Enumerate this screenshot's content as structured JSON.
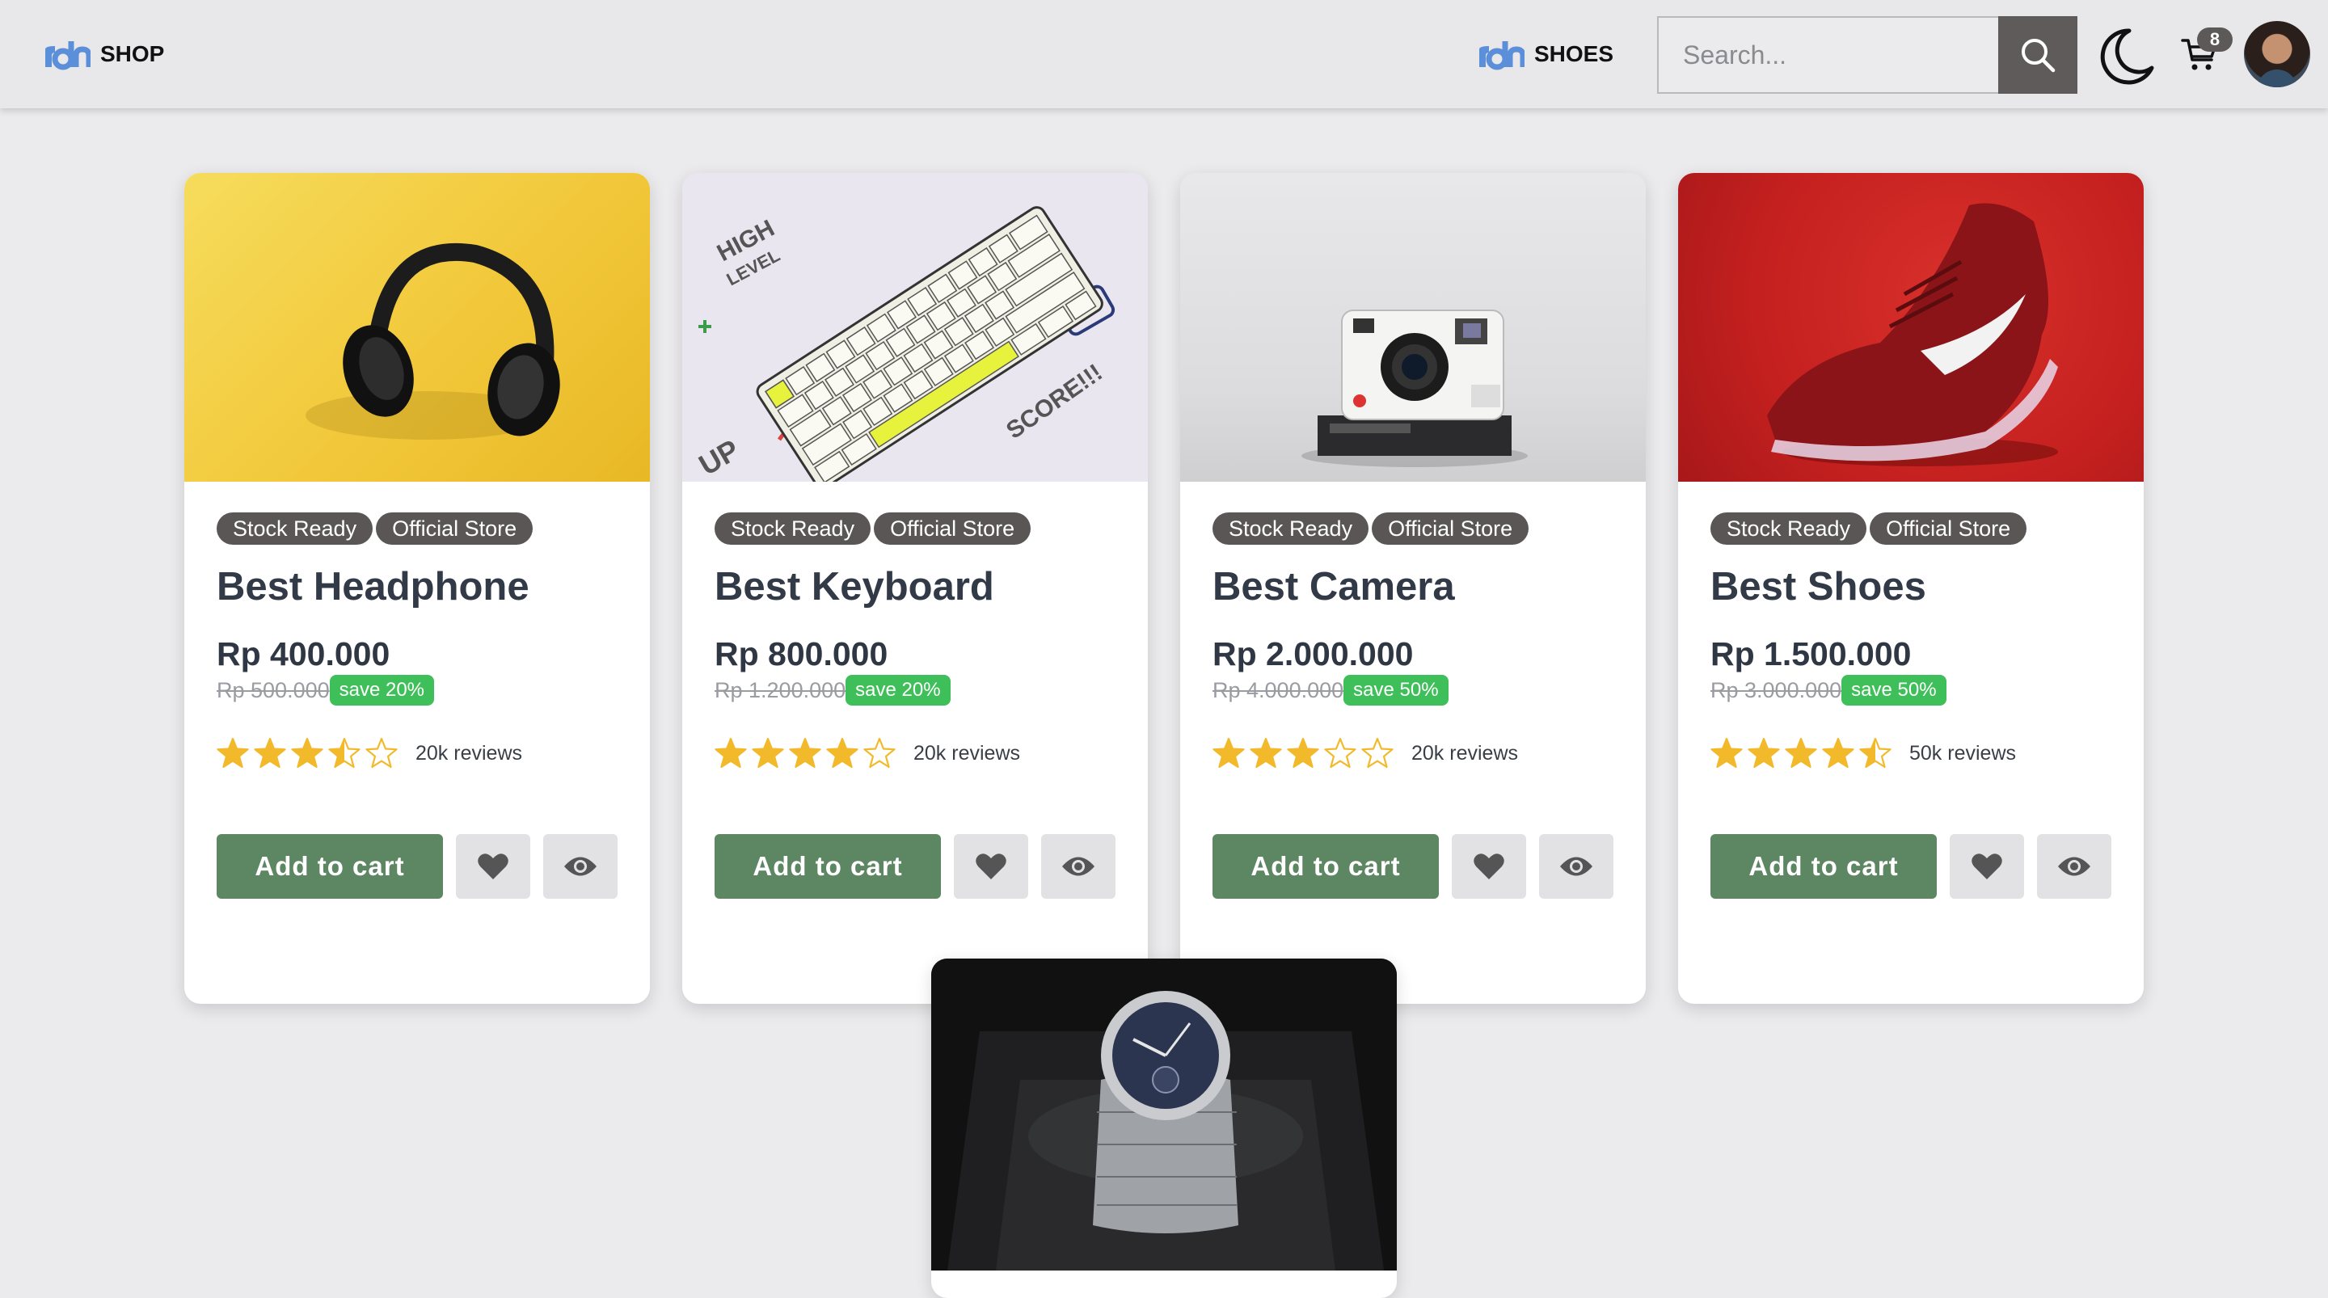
{
  "header": {
    "brand_left": "SHOP",
    "brand_right": "SHOES",
    "search_placeholder": "Search...",
    "cart_count": "8",
    "accent": "#5b8fd9"
  },
  "products": [
    {
      "tags": [
        "Stock Ready",
        "Official Store"
      ],
      "title": "Best Headphone",
      "price": "Rp 400.000",
      "old_price": "Rp 500.000",
      "save": "save 20%",
      "rating": 3.5,
      "reviews": "20k reviews",
      "cart_label": "Add to cart",
      "image": "headphone-photo"
    },
    {
      "tags": [
        "Stock Ready",
        "Official Store"
      ],
      "title": "Best Keyboard",
      "price": "Rp 800.000",
      "old_price": "Rp 1.200.000",
      "save": "save 20%",
      "rating": 4,
      "reviews": "20k reviews",
      "cart_label": "Add to cart",
      "image": "keyboard-photo"
    },
    {
      "tags": [
        "Stock Ready",
        "Official Store"
      ],
      "title": "Best Camera",
      "price": "Rp 2.000.000",
      "old_price": "Rp 4.000.000",
      "save": "save 50%",
      "rating": 3,
      "reviews": "20k reviews",
      "cart_label": "Add to cart",
      "image": "camera-photo"
    },
    {
      "tags": [
        "Stock Ready",
        "Official Store"
      ],
      "title": "Best Shoes",
      "price": "Rp 1.500.000",
      "old_price": "Rp 3.000.000",
      "save": "save 50%",
      "rating": 4.5,
      "reviews": "50k reviews",
      "cart_label": "Add to cart",
      "image": "shoe-photo"
    },
    {
      "image": "watch-photo"
    }
  ],
  "colors": {
    "tag_bg": "#5a5656",
    "save_bg": "#3fbf5a",
    "cart_button": "#5d8763",
    "star": "#f2b92b"
  }
}
